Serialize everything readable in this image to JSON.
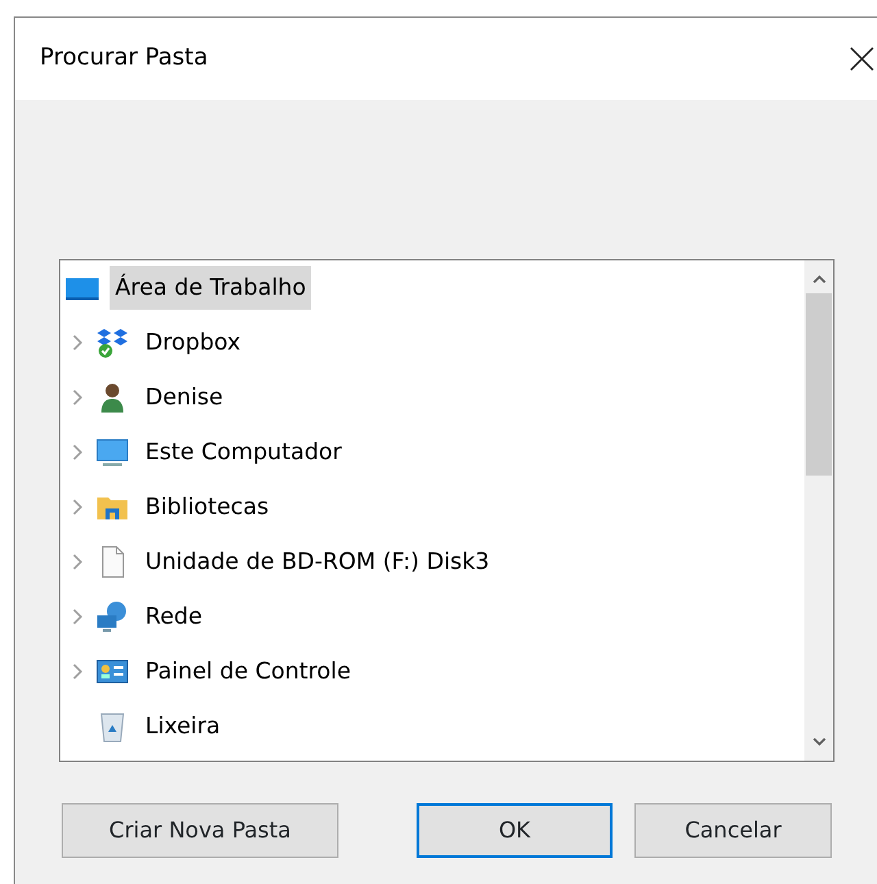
{
  "window": {
    "title": "Procurar Pasta"
  },
  "tree": {
    "items": [
      {
        "label": "Área de Trabalho",
        "kind": "desktop",
        "expandable": false,
        "selected": true
      },
      {
        "label": "Dropbox",
        "kind": "dropbox",
        "expandable": true,
        "selected": false
      },
      {
        "label": "Denise",
        "kind": "user",
        "expandable": true,
        "selected": false
      },
      {
        "label": "Este Computador",
        "kind": "computer",
        "expandable": true,
        "selected": false
      },
      {
        "label": "Bibliotecas",
        "kind": "library",
        "expandable": true,
        "selected": false
      },
      {
        "label": "Unidade de BD-ROM (F:) Disk3",
        "kind": "drive",
        "expandable": true,
        "selected": false
      },
      {
        "label": "Rede",
        "kind": "network",
        "expandable": true,
        "selected": false
      },
      {
        "label": "Painel de Controle",
        "kind": "control-panel",
        "expandable": true,
        "selected": false
      },
      {
        "label": "Lixeira",
        "kind": "recycle-bin",
        "expandable": false,
        "selected": false
      }
    ]
  },
  "buttons": [
    {
      "label": "Criar Nova Pasta",
      "default": false
    },
    {
      "label": "OK",
      "default": true
    },
    {
      "label": "Cancelar",
      "default": false
    }
  ]
}
